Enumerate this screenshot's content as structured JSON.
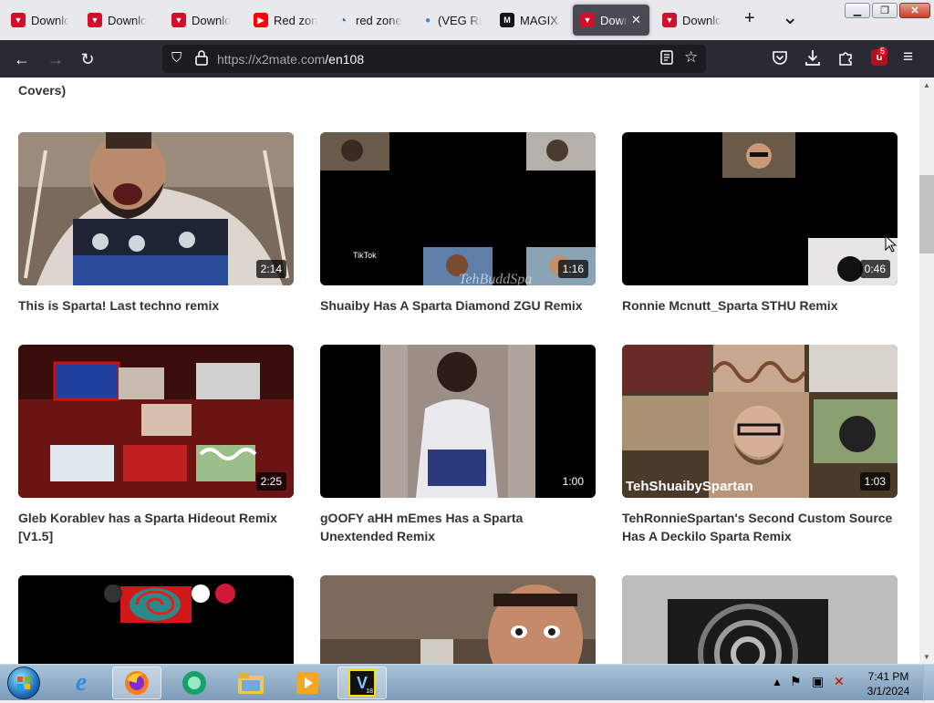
{
  "browser": {
    "tabs": [
      {
        "title": "Downlo",
        "icon": "download-icon",
        "active": false
      },
      {
        "title": "Downlo",
        "icon": "download-icon",
        "active": false
      },
      {
        "title": "Downlo",
        "icon": "download-icon",
        "active": false
      },
      {
        "title": "Red zone",
        "icon": "youtube-icon",
        "active": false
      },
      {
        "title": "red zone",
        "icon": "edge-icon",
        "active": false
      },
      {
        "title": "(VEG REF",
        "icon": "dot-icon",
        "active": false
      },
      {
        "title": "MAGIX -",
        "icon": "magix-icon",
        "active": false
      },
      {
        "title": "Down",
        "icon": "download-icon",
        "active": true
      },
      {
        "title": "Downlo",
        "icon": "download-icon",
        "active": false
      }
    ],
    "new_tab_glyph": "+",
    "tab_list_glyph": "⌄",
    "url_host": "https://x2mate.com",
    "url_path": "/en108",
    "extension_badge": "5"
  },
  "page": {
    "top_partial_text": "Covers)",
    "videos": [
      {
        "title": "This is Sparta! Last techno remix",
        "duration": "2:14"
      },
      {
        "title": "Shuaiby Has A Sparta Diamond ZGU Remix",
        "duration": "1:16"
      },
      {
        "title": "Ronnie Mcnutt_Sparta STHU Remix",
        "duration": "0:46"
      },
      {
        "title": "Gleb Korablev has a Sparta Hideout Remix [V1.5]",
        "duration": "2:25"
      },
      {
        "title": "gOOFY aHH mEmes Has a Sparta Unextended Remix",
        "duration": "1:00"
      },
      {
        "title": "TehRonnieSpartan's Second Custom Source Has A Deckilo Sparta Remix",
        "duration": "1:03"
      },
      {
        "title": "",
        "duration": ""
      },
      {
        "title": "",
        "duration": ""
      },
      {
        "title": "",
        "duration": ""
      }
    ],
    "thumb_overlay_texts": {
      "tehbudd": "TehBuddSpa",
      "tiktok": "TikTok",
      "tehshuaiby": "TehShuaibySpartan"
    }
  },
  "taskbar": {
    "clock_time": "7:41 PM",
    "clock_date": "3/1/2024",
    "pinned": [
      "internet-explorer-icon",
      "firefox-icon",
      "messaging-app-icon",
      "file-explorer-icon",
      "media-player-icon",
      "vegas-icon"
    ],
    "vegas_label": "V",
    "vegas_version": "18"
  },
  "colors": {
    "tab_strip": "#e8e8ed",
    "nav_bar": "#2b2a33",
    "url_field": "#1c1b22",
    "download_favicon": "#d0112b",
    "page_bg": "#ffffff"
  }
}
